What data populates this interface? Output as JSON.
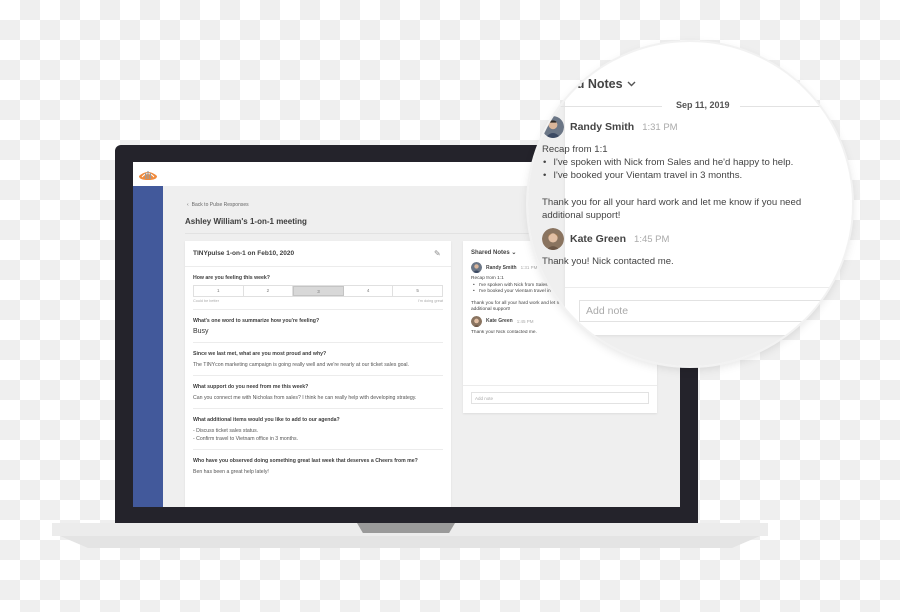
{
  "app": {
    "brand": "TINYpulse",
    "brand_colors": {
      "sidebar": "#42599b",
      "logo": "#f08a3c"
    }
  },
  "page": {
    "back_link": "Back to Pulse Responses",
    "title": "Ashley William's 1-on-1 meeting"
  },
  "form": {
    "title": "TINYpulse 1-on-1 on Feb10, 2020",
    "edit_icon": "pencil-icon",
    "rating": {
      "question": "How are you feeling this week?",
      "options": [
        "1",
        "2",
        "3",
        "4",
        "5"
      ],
      "selected": "3",
      "low_label": "Could be better",
      "high_label": "I'm doing great"
    },
    "questions": [
      {
        "label": "What's one word to summarize how you're feeling?",
        "answer": "Busy"
      },
      {
        "label": "Since we last met, what are you most proud and why?",
        "answer": "The TINYcon marketing campaign is going really well and we're nearly at our ticket sales goal."
      },
      {
        "label": "What support do you need from me this week?",
        "answer": "Can you connect me with Nicholas from sales? I think he can really help with developing strategy."
      },
      {
        "label": "What additional items would you like to add to our agenda?",
        "answer_lines": [
          "- Discuss ticket sales status.",
          "- Confirm travel to Vietnam office in 3 months."
        ]
      },
      {
        "label": "Who have you observed doing something great last week that deserves a Cheers from me?",
        "answer": "Ben has been a great help lately!"
      }
    ]
  },
  "notes": {
    "header": "Shared Notes",
    "date": "Sep 11, 2019",
    "add_note_placeholder": "Add note",
    "entries": [
      {
        "author": "Randy Smith",
        "time": "1:31 PM",
        "intro": "Recap from 1:1",
        "bullets": [
          "I've spoken with Nick from Sales and he'd happy to help.",
          "I've booked your Vientam travel in 3 months."
        ],
        "closing": "Thank you for all your hard work and let me know if you need additional support!",
        "closing_lines": [
          "Thank you for all your hard work and let me know if you need",
          "additional support!"
        ]
      },
      {
        "author": "Kate Green",
        "time": "1:45 PM",
        "text": "Thank you! Nick contacted me."
      }
    ]
  }
}
